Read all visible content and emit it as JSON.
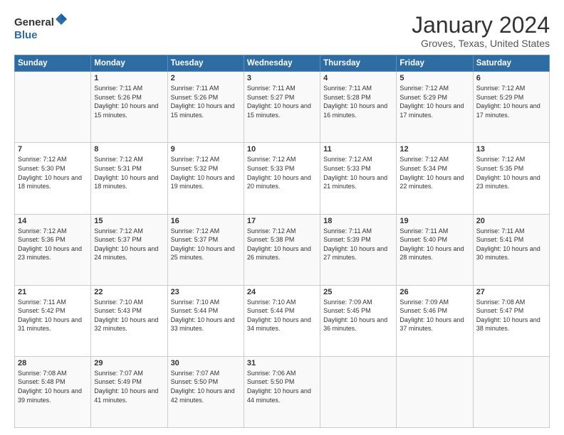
{
  "logo": {
    "general": "General",
    "blue": "Blue"
  },
  "header": {
    "month": "January 2024",
    "location": "Groves, Texas, United States"
  },
  "weekdays": [
    "Sunday",
    "Monday",
    "Tuesday",
    "Wednesday",
    "Thursday",
    "Friday",
    "Saturday"
  ],
  "weeks": [
    [
      {
        "day": "",
        "sunrise": "",
        "sunset": "",
        "daylight": ""
      },
      {
        "day": "1",
        "sunrise": "Sunrise: 7:11 AM",
        "sunset": "Sunset: 5:26 PM",
        "daylight": "Daylight: 10 hours and 15 minutes."
      },
      {
        "day": "2",
        "sunrise": "Sunrise: 7:11 AM",
        "sunset": "Sunset: 5:26 PM",
        "daylight": "Daylight: 10 hours and 15 minutes."
      },
      {
        "day": "3",
        "sunrise": "Sunrise: 7:11 AM",
        "sunset": "Sunset: 5:27 PM",
        "daylight": "Daylight: 10 hours and 15 minutes."
      },
      {
        "day": "4",
        "sunrise": "Sunrise: 7:11 AM",
        "sunset": "Sunset: 5:28 PM",
        "daylight": "Daylight: 10 hours and 16 minutes."
      },
      {
        "day": "5",
        "sunrise": "Sunrise: 7:12 AM",
        "sunset": "Sunset: 5:29 PM",
        "daylight": "Daylight: 10 hours and 17 minutes."
      },
      {
        "day": "6",
        "sunrise": "Sunrise: 7:12 AM",
        "sunset": "Sunset: 5:29 PM",
        "daylight": "Daylight: 10 hours and 17 minutes."
      }
    ],
    [
      {
        "day": "7",
        "sunrise": "Sunrise: 7:12 AM",
        "sunset": "Sunset: 5:30 PM",
        "daylight": "Daylight: 10 hours and 18 minutes."
      },
      {
        "day": "8",
        "sunrise": "Sunrise: 7:12 AM",
        "sunset": "Sunset: 5:31 PM",
        "daylight": "Daylight: 10 hours and 18 minutes."
      },
      {
        "day": "9",
        "sunrise": "Sunrise: 7:12 AM",
        "sunset": "Sunset: 5:32 PM",
        "daylight": "Daylight: 10 hours and 19 minutes."
      },
      {
        "day": "10",
        "sunrise": "Sunrise: 7:12 AM",
        "sunset": "Sunset: 5:33 PM",
        "daylight": "Daylight: 10 hours and 20 minutes."
      },
      {
        "day": "11",
        "sunrise": "Sunrise: 7:12 AM",
        "sunset": "Sunset: 5:33 PM",
        "daylight": "Daylight: 10 hours and 21 minutes."
      },
      {
        "day": "12",
        "sunrise": "Sunrise: 7:12 AM",
        "sunset": "Sunset: 5:34 PM",
        "daylight": "Daylight: 10 hours and 22 minutes."
      },
      {
        "day": "13",
        "sunrise": "Sunrise: 7:12 AM",
        "sunset": "Sunset: 5:35 PM",
        "daylight": "Daylight: 10 hours and 23 minutes."
      }
    ],
    [
      {
        "day": "14",
        "sunrise": "Sunrise: 7:12 AM",
        "sunset": "Sunset: 5:36 PM",
        "daylight": "Daylight: 10 hours and 23 minutes."
      },
      {
        "day": "15",
        "sunrise": "Sunrise: 7:12 AM",
        "sunset": "Sunset: 5:37 PM",
        "daylight": "Daylight: 10 hours and 24 minutes."
      },
      {
        "day": "16",
        "sunrise": "Sunrise: 7:12 AM",
        "sunset": "Sunset: 5:37 PM",
        "daylight": "Daylight: 10 hours and 25 minutes."
      },
      {
        "day": "17",
        "sunrise": "Sunrise: 7:12 AM",
        "sunset": "Sunset: 5:38 PM",
        "daylight": "Daylight: 10 hours and 26 minutes."
      },
      {
        "day": "18",
        "sunrise": "Sunrise: 7:11 AM",
        "sunset": "Sunset: 5:39 PM",
        "daylight": "Daylight: 10 hours and 27 minutes."
      },
      {
        "day": "19",
        "sunrise": "Sunrise: 7:11 AM",
        "sunset": "Sunset: 5:40 PM",
        "daylight": "Daylight: 10 hours and 28 minutes."
      },
      {
        "day": "20",
        "sunrise": "Sunrise: 7:11 AM",
        "sunset": "Sunset: 5:41 PM",
        "daylight": "Daylight: 10 hours and 30 minutes."
      }
    ],
    [
      {
        "day": "21",
        "sunrise": "Sunrise: 7:11 AM",
        "sunset": "Sunset: 5:42 PM",
        "daylight": "Daylight: 10 hours and 31 minutes."
      },
      {
        "day": "22",
        "sunrise": "Sunrise: 7:10 AM",
        "sunset": "Sunset: 5:43 PM",
        "daylight": "Daylight: 10 hours and 32 minutes."
      },
      {
        "day": "23",
        "sunrise": "Sunrise: 7:10 AM",
        "sunset": "Sunset: 5:44 PM",
        "daylight": "Daylight: 10 hours and 33 minutes."
      },
      {
        "day": "24",
        "sunrise": "Sunrise: 7:10 AM",
        "sunset": "Sunset: 5:44 PM",
        "daylight": "Daylight: 10 hours and 34 minutes."
      },
      {
        "day": "25",
        "sunrise": "Sunrise: 7:09 AM",
        "sunset": "Sunset: 5:45 PM",
        "daylight": "Daylight: 10 hours and 36 minutes."
      },
      {
        "day": "26",
        "sunrise": "Sunrise: 7:09 AM",
        "sunset": "Sunset: 5:46 PM",
        "daylight": "Daylight: 10 hours and 37 minutes."
      },
      {
        "day": "27",
        "sunrise": "Sunrise: 7:08 AM",
        "sunset": "Sunset: 5:47 PM",
        "daylight": "Daylight: 10 hours and 38 minutes."
      }
    ],
    [
      {
        "day": "28",
        "sunrise": "Sunrise: 7:08 AM",
        "sunset": "Sunset: 5:48 PM",
        "daylight": "Daylight: 10 hours and 39 minutes."
      },
      {
        "day": "29",
        "sunrise": "Sunrise: 7:07 AM",
        "sunset": "Sunset: 5:49 PM",
        "daylight": "Daylight: 10 hours and 41 minutes."
      },
      {
        "day": "30",
        "sunrise": "Sunrise: 7:07 AM",
        "sunset": "Sunset: 5:50 PM",
        "daylight": "Daylight: 10 hours and 42 minutes."
      },
      {
        "day": "31",
        "sunrise": "Sunrise: 7:06 AM",
        "sunset": "Sunset: 5:50 PM",
        "daylight": "Daylight: 10 hours and 44 minutes."
      },
      {
        "day": "",
        "sunrise": "",
        "sunset": "",
        "daylight": ""
      },
      {
        "day": "",
        "sunrise": "",
        "sunset": "",
        "daylight": ""
      },
      {
        "day": "",
        "sunrise": "",
        "sunset": "",
        "daylight": ""
      }
    ]
  ]
}
